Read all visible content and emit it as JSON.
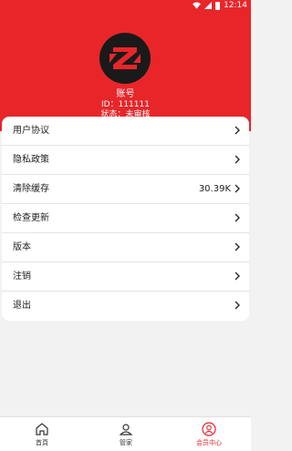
{
  "status_bar": {
    "time": "12:14"
  },
  "profile": {
    "name": "账号",
    "id_line": "ID：111111",
    "status_line": "状态：未审核"
  },
  "menu": [
    {
      "label": "用户协议",
      "value": ""
    },
    {
      "label": "隐私政策",
      "value": ""
    },
    {
      "label": "清除缓存",
      "value": "30.39K"
    },
    {
      "label": "检查更新",
      "value": ""
    },
    {
      "label": "版本",
      "value": ""
    },
    {
      "label": "注销",
      "value": ""
    },
    {
      "label": "退出",
      "value": ""
    }
  ],
  "tabs": [
    {
      "label": "首頁",
      "icon": "home-icon",
      "active": false
    },
    {
      "label": "管家",
      "icon": "butler-icon",
      "active": false
    },
    {
      "label": "会员中心",
      "icon": "member-icon",
      "active": true
    }
  ],
  "colors": {
    "accent": "#e8262a",
    "logo_bg": "#1a1a1a"
  }
}
